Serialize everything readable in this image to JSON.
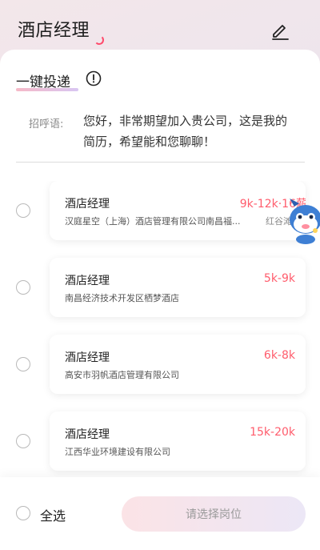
{
  "header": {
    "title": "酒店经理"
  },
  "section": {
    "title": "一键投递"
  },
  "greeting": {
    "label": "招呼语:",
    "text": "您好，非常期望加入贵公司，这是我的简历，希望能和您聊聊！"
  },
  "jobs": [
    {
      "title": "酒店经理",
      "salary": "9k-12k·16薪",
      "company": "汉庭星空（上海）酒店管理有限公司南昌福...",
      "location": "红谷滩区"
    },
    {
      "title": "酒店经理",
      "salary": "5k-9k",
      "company": "南昌经济技术开发区栖梦酒店",
      "location": ""
    },
    {
      "title": "酒店经理",
      "salary": "6k-8k",
      "company": "高安市羽帆酒店管理有限公司",
      "location": ""
    },
    {
      "title": "酒店经理",
      "salary": "15k-20k",
      "company": "江西华业环境建设有限公司",
      "location": ""
    }
  ],
  "footer": {
    "select_all": "全选",
    "submit": "请选择岗位"
  },
  "icons": {
    "edit": "edit-icon",
    "info": "info-icon",
    "mascot": "mascot-icon"
  },
  "colors": {
    "salary": "#ff5c6c",
    "accent_pink": "#f6b9c7",
    "accent_purple": "#d8c6f2"
  }
}
